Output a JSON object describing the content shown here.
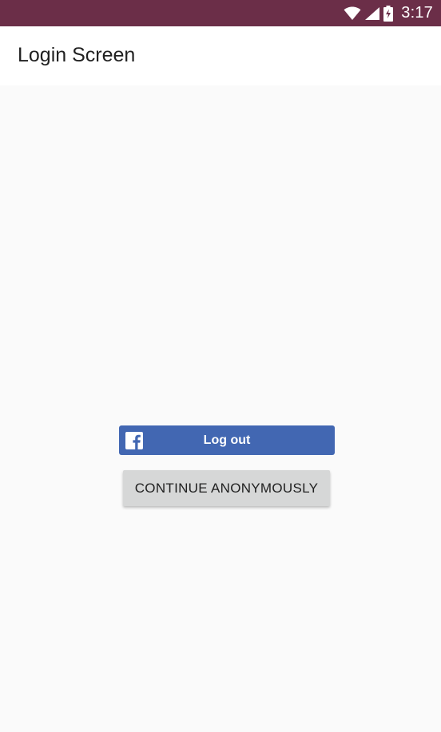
{
  "status_bar": {
    "time": "3:17",
    "background_color": "#6b2e48",
    "icons": [
      "wifi-icon",
      "signal-icon",
      "battery-charging-icon"
    ]
  },
  "app_bar": {
    "title": "Login Screen"
  },
  "facebook_button": {
    "label": "Log out",
    "icon": "facebook-icon",
    "color": "#4267b2"
  },
  "anonymous_button": {
    "label": "CONTINUE ANONYMOUSLY",
    "color": "#d6d7d7"
  }
}
